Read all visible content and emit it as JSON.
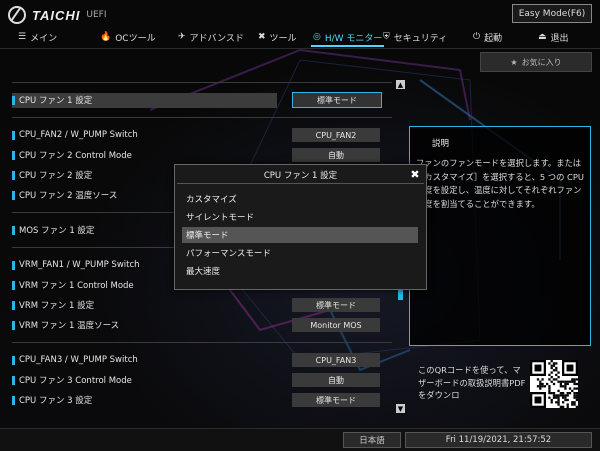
{
  "brand": {
    "name": "TAICHI",
    "sub": "UEFI"
  },
  "mode_button": "Easy Mode(F6)",
  "nav": [
    {
      "icon": "menu-icon",
      "glyph": "☰",
      "label": "メイン"
    },
    {
      "icon": "flame-icon",
      "glyph": "🔥",
      "label": "OCツール"
    },
    {
      "icon": "rocket-icon",
      "glyph": "✈",
      "label": "アドバンスド"
    },
    {
      "icon": "tools-icon",
      "glyph": "✖",
      "label": "ツール"
    },
    {
      "icon": "monitor-icon",
      "glyph": "◎",
      "label": "H/W モニター"
    },
    {
      "icon": "shield-icon",
      "glyph": "⛨",
      "label": "セキュリティ"
    },
    {
      "icon": "power-icon",
      "glyph": "⏻",
      "label": "起動"
    },
    {
      "icon": "exit-icon",
      "glyph": "⏏",
      "label": "退出"
    }
  ],
  "favorites_button": "お気に入り",
  "settings": [
    {
      "label": "CPU ファン 1 設定",
      "value": "標準モード",
      "selected": true
    },
    {
      "label": "CPU_FAN2 / W_PUMP Switch",
      "value": "CPU_FAN2"
    },
    {
      "label": "CPU ファン 2 Control Mode",
      "value": "自動"
    },
    {
      "label": "CPU ファン 2 設定",
      "value": "標準モード"
    },
    {
      "label": "CPU ファン 2 温度ソース",
      "value": ""
    },
    {
      "label": "MOS ファン 1 設定",
      "value": ""
    },
    {
      "label": "VRM_FAN1 / W_PUMP Switch",
      "value": ""
    },
    {
      "label": "VRM ファン 1 Control Mode",
      "value": ""
    },
    {
      "label": "VRM ファン 1 設定",
      "value": "標準モード"
    },
    {
      "label": "VRM ファン 1 温度ソース",
      "value": "Monitor MOS"
    },
    {
      "label": "CPU_FAN3 / W_PUMP Switch",
      "value": "CPU_FAN3"
    },
    {
      "label": "CPU ファン 3 Control Mode",
      "value": "自動"
    },
    {
      "label": "CPU ファン 3 設定",
      "value": "標準モード"
    }
  ],
  "description": {
    "title": "説明",
    "body": "ファンのファンモードを選択します。または［カスタマイズ］を選択すると、5 つの CPU 温度を設定し、温度に対してそれぞれファン速度を割当てることができます。"
  },
  "qr_text": "このQRコードを使って、マザーボードの取扱説明書PDFをダウンロ",
  "popup": {
    "title": "CPU ファン 1 設定",
    "options": [
      "カスタマイズ",
      "サイレントモード",
      "標準モード",
      "パフォーマンスモード",
      "最大速度"
    ],
    "selected_index": 2
  },
  "footer": {
    "language": "日本語",
    "datetime": "Fri 11/19/2021, 21:57:52"
  },
  "colors": {
    "accent": "#29b6e8",
    "nav_active": "#4fd7ff"
  }
}
